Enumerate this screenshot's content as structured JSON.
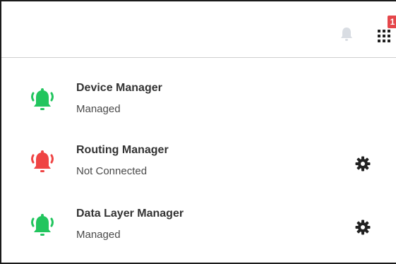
{
  "header": {
    "notification_icon": "bell-icon",
    "apps_icon": "grid-icon",
    "badge_text": "1"
  },
  "colors": {
    "managed": "#22c55e",
    "not_connected": "#ef4444",
    "badge": "#e5474b",
    "header_bell": "#d9dde3"
  },
  "managers": [
    {
      "title": "Device Manager",
      "status": "Managed",
      "icon": "bell-ringing-icon",
      "status_color": "#22c55e",
      "has_settings": false
    },
    {
      "title": "Routing Manager",
      "status": "Not Connected",
      "icon": "bell-ringing-icon",
      "status_color": "#ef4444",
      "has_settings": true
    },
    {
      "title": "Data Layer Manager",
      "status": "Managed",
      "icon": "bell-ringing-icon",
      "status_color": "#22c55e",
      "has_settings": true
    }
  ]
}
